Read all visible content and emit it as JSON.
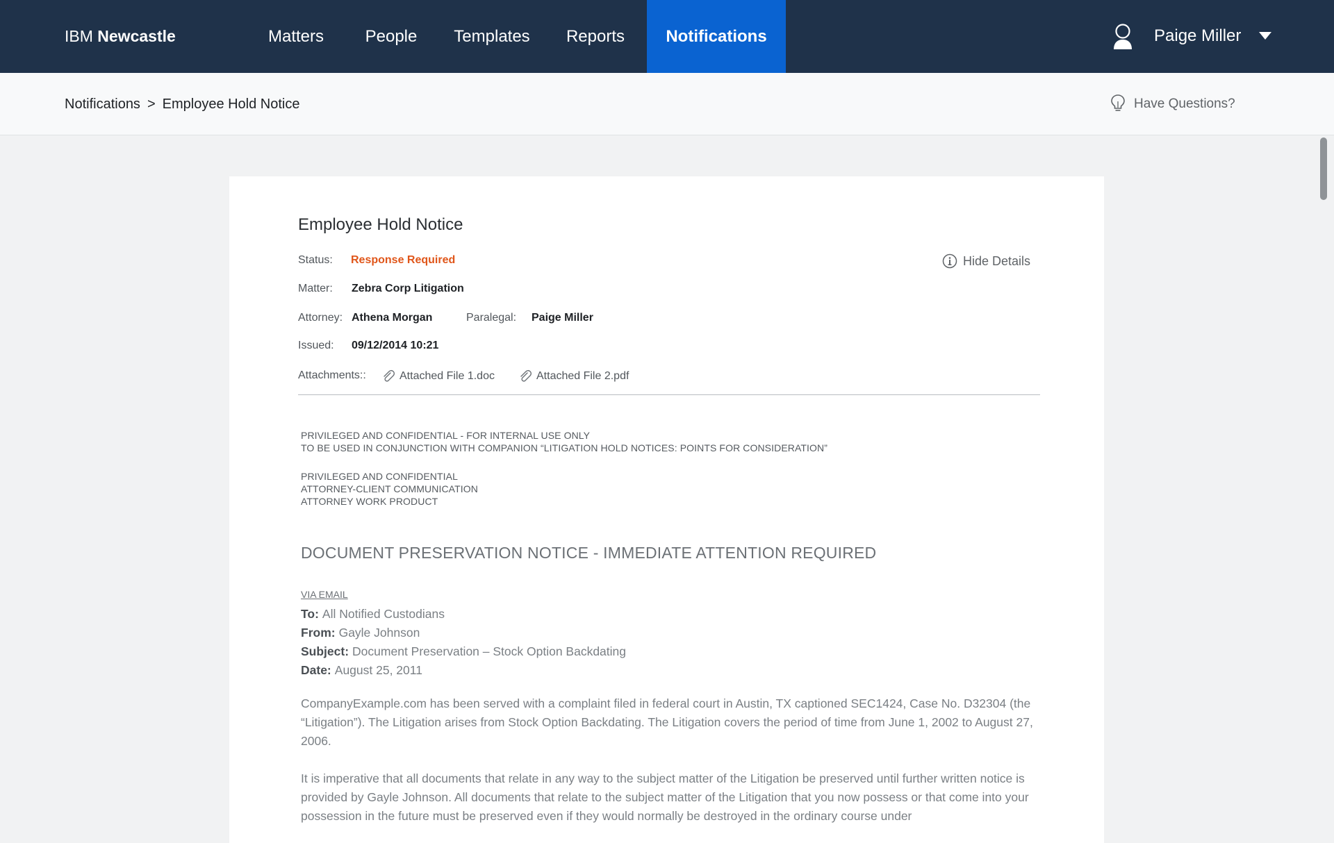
{
  "brand": {
    "prefix": "IBM",
    "name": "Newcastle"
  },
  "nav": {
    "items": [
      "Matters",
      "People",
      "Templates",
      "Reports",
      "Notifications"
    ],
    "active": "Notifications"
  },
  "user": {
    "name": "Paige Miller",
    "icon": "user-icon"
  },
  "breadcrumb": {
    "parent": "Notifications",
    "separator": ">",
    "current": "Employee Hold Notice"
  },
  "help": {
    "label": "Have Questions?",
    "icon": "lightbulb-icon"
  },
  "notice": {
    "title": "Employee Hold Notice",
    "status_label": "Status:",
    "status_value": "Response Required",
    "matter_label": "Matter:",
    "matter_value": "Zebra Corp Litigation",
    "attorney_label": "Attorney:",
    "attorney_value": "Athena Morgan",
    "paralegal_label": "Paralegal:",
    "paralegal_value": "Paige Miller",
    "issued_label": "Issued:",
    "issued_value": "09/12/2014 10:21",
    "attachments_label": "Attachments::",
    "attachments": [
      "Attached File 1.doc",
      "Attached File 2.pdf"
    ],
    "hide_details": "Hide Details"
  },
  "document": {
    "conf_line1": "PRIVILEGED AND CONFIDENTIAL -  FOR INTERNAL USE ONLY",
    "conf_line2": "TO BE USED IN CONJUNCTION WITH COMPANION “LITIGATION HOLD NOTICES: POINTS FOR CONSIDERATION”",
    "priv_line1": "PRIVILEGED AND CONFIDENTIAL",
    "priv_line2": "ATTORNEY-CLIENT COMMUNICATION",
    "priv_line3": "ATTORNEY WORK PRODUCT",
    "heading": "DOCUMENT PRESERVATION NOTICE - IMMEDIATE ATTENTION REQUIRED",
    "via": "VIA EMAIL",
    "to_label": "To:",
    "to_value": "All Notified Custodians",
    "from_label": "From:",
    "from_value": "Gayle Johnson",
    "subject_label": "Subject:",
    "subject_value": "Document Preservation – Stock Option Backdating",
    "date_label": "Date:",
    "date_value": "August 25, 2011",
    "para1": "CompanyExample.com has been served with a complaint filed in federal court in Austin, TX captioned SEC1424, Case No. D32304 (the “Litigation”).  The Litigation arises from Stock Option Backdating.  The Litigation covers the period of time from June 1, 2002 to August 27, 2006.",
    "para2": "It is imperative that all documents that relate in any way to the subject matter of the Litigation be preserved until further written notice is provided by Gayle Johnson.  All documents that relate to the subject matter of the Litigation that you now possess or that come into your possession in the future must be preserved even if they would normally be destroyed in the ordinary course under"
  },
  "colors": {
    "nav_bg": "#1f324a",
    "nav_active": "#0a63d1",
    "status": "#e0561a"
  }
}
